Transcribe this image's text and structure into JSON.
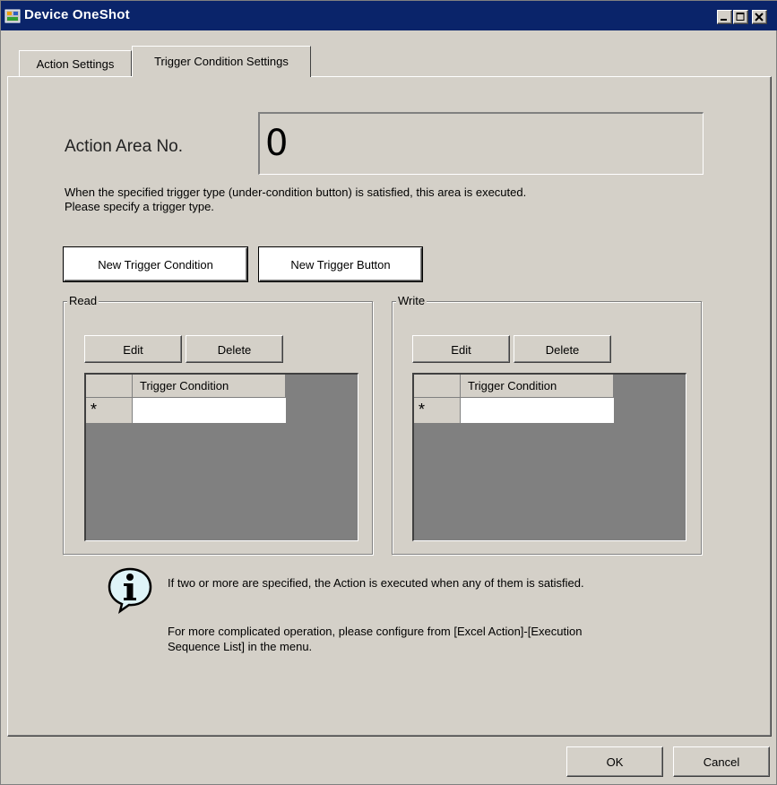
{
  "window": {
    "title": "Device OneShot"
  },
  "tabs": [
    {
      "label": "Action Settings"
    },
    {
      "label": "Trigger Condition Settings"
    }
  ],
  "action_area": {
    "label": "Action Area No.",
    "value": "0"
  },
  "description": {
    "line1": "When the specified trigger type (under-condition button) is satisfied, this area is executed.",
    "line2": "Please specify a trigger type."
  },
  "buttons": {
    "new_condition": "New Trigger Condition",
    "new_button": "New Trigger Button",
    "ok": "OK",
    "cancel": "Cancel"
  },
  "read_group": {
    "legend": "Read",
    "edit": "Edit",
    "delete": "Delete",
    "column": "Trigger Condition",
    "new_row_marker": "*"
  },
  "write_group": {
    "legend": "Write",
    "edit": "Edit",
    "delete": "Delete",
    "column": "Trigger Condition",
    "new_row_marker": "*"
  },
  "info": {
    "note1": "If two or more are specified, the Action is executed when any of them is satisfied.",
    "note2_line1": "For more complicated operation, please configure from [Excel Action]-[Execution",
    "note2_line2": "Sequence List] in the menu."
  },
  "icons": {
    "app": "app-icon",
    "minimize": "minimize-icon",
    "maximize": "maximize-icon",
    "close": "close-icon",
    "info": "info-icon"
  },
  "colors": {
    "titlebar": "#0a246a",
    "face": "#d4d0c8",
    "grid_bg": "#808080"
  }
}
